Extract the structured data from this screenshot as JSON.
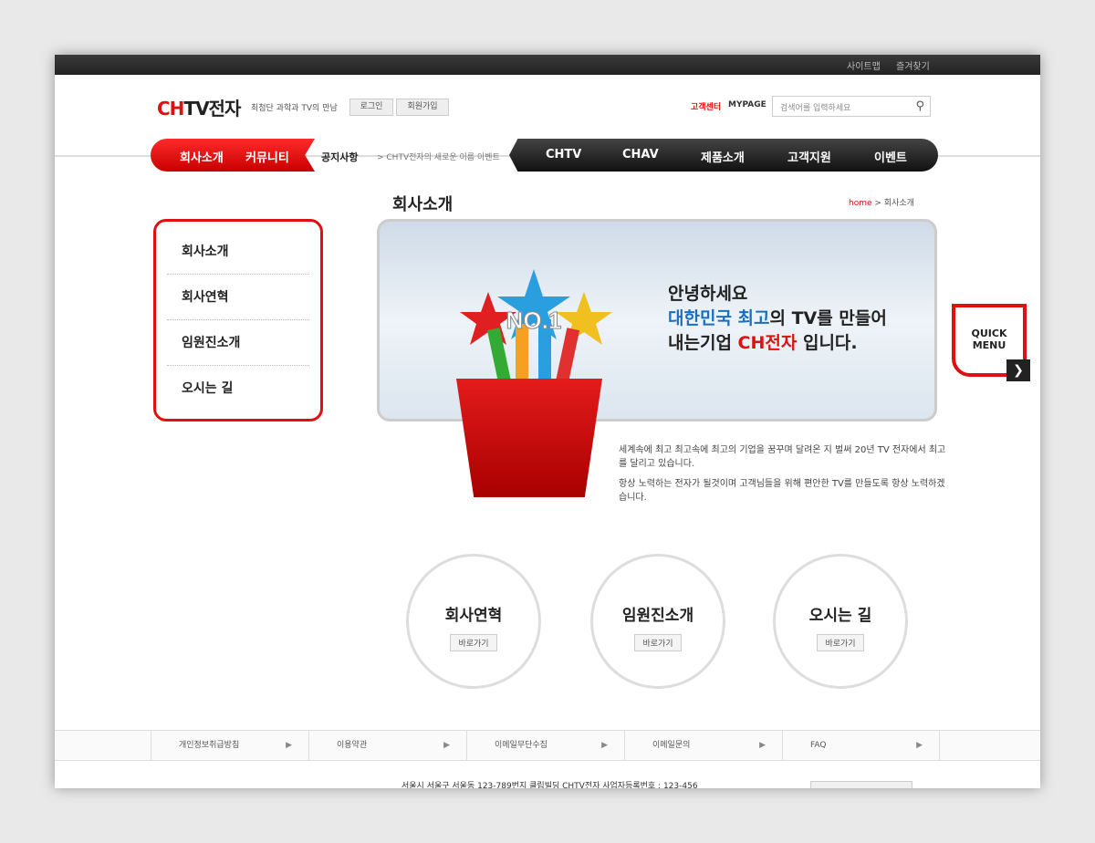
{
  "topbar": {
    "links": [
      "사이트맵",
      "즐겨찾기"
    ]
  },
  "header": {
    "logo_red": "CH",
    "logo_rest": "TV전자",
    "tagline": "최첨단 과학과 TV의 만남",
    "login": "로그인",
    "join": "회원가입",
    "customer_center": "고객센터",
    "mypage": "MYPAGE",
    "search_placeholder": "검색어를 입력하세요"
  },
  "nav": {
    "red_items": [
      "회사소개",
      "커뮤니티"
    ],
    "notice_label": "공지사항",
    "notice_text": "> CHTV전자의 새로운 이름 이벤트",
    "main_items": [
      "CHTV",
      "CHAV",
      "제품소개",
      "고객지원",
      "이벤트"
    ]
  },
  "sidebar": {
    "items": [
      "회사소개",
      "회사연혁",
      "임원진소개",
      "오시는 길"
    ]
  },
  "page": {
    "title": "회사소개",
    "breadcrumb_home": "home",
    "breadcrumb_current": "> 회사소개"
  },
  "banner": {
    "line1": "안녕하세요",
    "line2_blue": "대한민국 최고",
    "line2_rest": "의 TV를 만들어",
    "line3_pre": "내는기업 ",
    "line3_red": "CH전자",
    "line3_post": " 입니다.",
    "badge": "NO.1"
  },
  "quick_menu": {
    "label1": "QUICK",
    "label2": "MENU"
  },
  "description": [
    "세계속에 최고 최고속에 최고의 기업을 꿈꾸며 달려온 지 벌써 20년 TV 전자에서 최고를 달리고 있습니다.",
    "항상 노력하는 전자가 될것이며 고객님들을 위해 편안한  TV를 만들도록 항상 노력하겠습니다."
  ],
  "circles": [
    {
      "title": "회사연혁",
      "button": "바로가기"
    },
    {
      "title": "임원진소개",
      "button": "바로가기"
    },
    {
      "title": "오시는 길",
      "button": "바로가기"
    }
  ],
  "footer": {
    "links": [
      "개인정보취급방침",
      "이용약관",
      "이메일무단수집",
      "이메일문의",
      "FAQ"
    ],
    "address": "서울시 서울구 서울동 123-789번지 클립빌딩 CHTV전자 사업자등록번호 : 123-456"
  },
  "colors": {
    "accent": "#e01010",
    "dark": "#222222",
    "blue": "#1a6fc0"
  }
}
